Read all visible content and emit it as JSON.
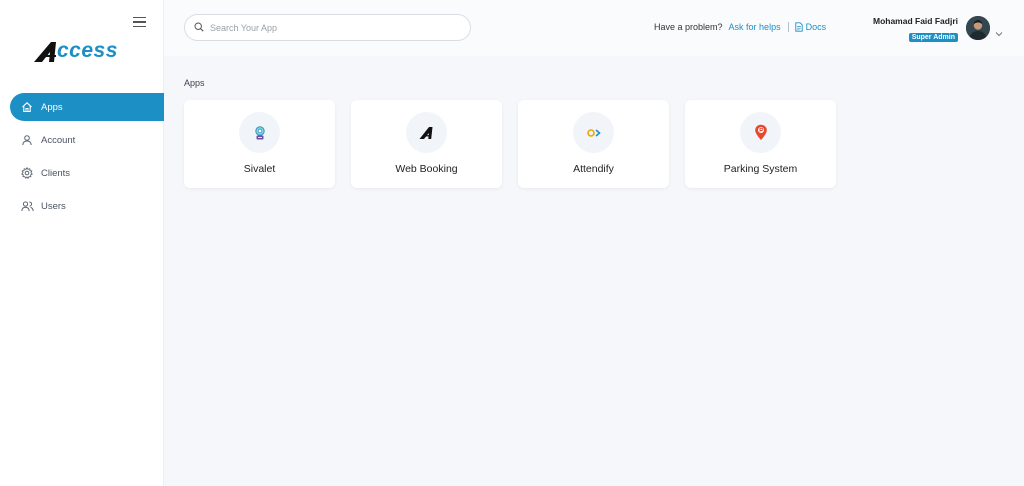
{
  "sidebar": {
    "logo_text": "ccess",
    "items": [
      {
        "label": "Apps",
        "icon": "home-icon",
        "active": true
      },
      {
        "label": "Account",
        "icon": "user-icon",
        "active": false
      },
      {
        "label": "Clients",
        "icon": "gear-icon",
        "active": false
      },
      {
        "label": "Users",
        "icon": "users-icon",
        "active": false
      }
    ]
  },
  "header": {
    "search_placeholder": "Search Your App",
    "help_prompt": "Have a problem?",
    "help_link": "Ask for helps",
    "docs_link": "Docs",
    "user_name": "Mohamad Faid Fadjri",
    "user_role": "Super Admin"
  },
  "main": {
    "section_title": "Apps",
    "apps": [
      {
        "label": "Sivalet",
        "icon": "sivalet-icon"
      },
      {
        "label": "Web Booking",
        "icon": "web-booking-icon"
      },
      {
        "label": "Attendify",
        "icon": "attendify-icon"
      },
      {
        "label": "Parking System",
        "icon": "parking-pin-icon"
      }
    ]
  },
  "colors": {
    "accent": "#1c8fc4",
    "background": "#f5f7fb",
    "sidebar": "#ffffff"
  }
}
